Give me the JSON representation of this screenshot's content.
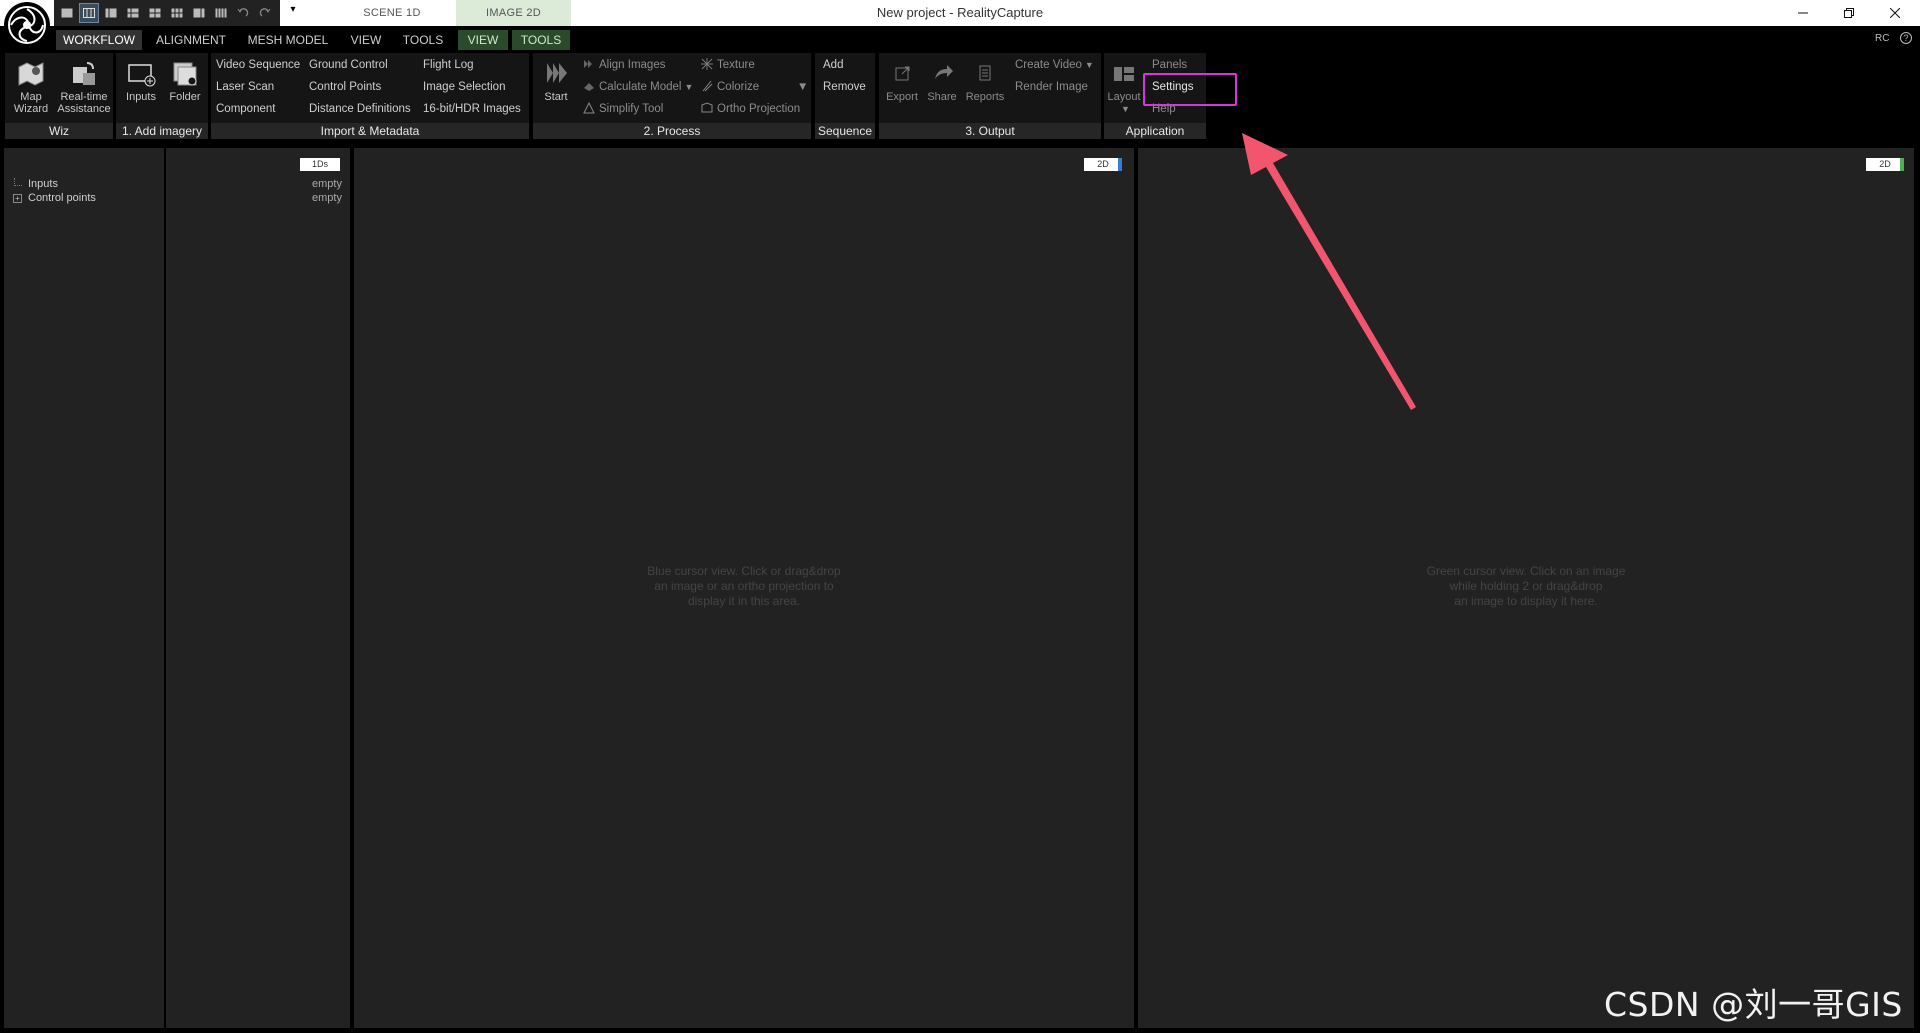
{
  "window": {
    "title": "New project - RealityCapture",
    "scene_tabs": [
      "SCENE 1D",
      "IMAGE 2D"
    ],
    "quick_access_dropdown": "▾"
  },
  "ribbon_tabs": [
    "WORKFLOW",
    "ALIGNMENT",
    "MESH MODEL",
    "VIEW",
    "TOOLS",
    "VIEW",
    "TOOLS"
  ],
  "top_right": {
    "rc": "RC",
    "help": "?"
  },
  "groups": {
    "wiz": {
      "title": "Wiz",
      "map_wizard": [
        "Map",
        "Wizard"
      ],
      "realtime": [
        "Real-time",
        "Assistance"
      ]
    },
    "add_imagery": {
      "title": "1. Add imagery",
      "inputs": "Inputs",
      "folder": "Folder"
    },
    "import_metadata": {
      "title": "Import & Metadata",
      "col1": [
        "Video Sequence",
        "Laser Scan",
        "Component"
      ],
      "col2": [
        "Ground Control",
        "Control Points",
        "Distance Definitions"
      ],
      "col3": [
        "Flight Log",
        "Image Selection",
        "16-bit/HDR Images"
      ]
    },
    "process": {
      "title": "2. Process",
      "start": "Start",
      "col1": [
        "Align Images",
        "Calculate Model",
        "Simplify Tool"
      ],
      "col2": [
        "Texture",
        "Colorize",
        "Ortho Projection"
      ]
    },
    "sequence": {
      "title": "Sequence",
      "items": [
        "Add",
        "Remove"
      ]
    },
    "output": {
      "title": "3. Output",
      "export": "Export",
      "share": "Share",
      "reports": "Reports",
      "items": [
        "Create Video",
        "Render Image"
      ]
    },
    "application": {
      "title": "Application",
      "layout": "Layout",
      "items": [
        "Panels",
        "Settings",
        "Help"
      ]
    }
  },
  "panels": {
    "tree": {
      "items": [
        "Inputs",
        "Control points"
      ]
    },
    "info": {
      "badge": "1Ds",
      "values": [
        "empty",
        "empty"
      ]
    },
    "blue_view": {
      "badge": "2D",
      "accent": "#3a7bd5",
      "placeholder": [
        "Blue cursor view. Click or drag&drop",
        "an image or an ortho projection to",
        "display it in this area."
      ]
    },
    "green_view": {
      "badge": "2D",
      "accent": "#4caf50",
      "placeholder": [
        "Green cursor view. Click on an image",
        "while holding 2 or drag&drop",
        "an image to display it here."
      ]
    }
  },
  "annotation": {
    "highlight_color": "#d23ad8",
    "arrow_color": "#f2566e"
  },
  "watermark": "CSDN @刘一哥GIS"
}
